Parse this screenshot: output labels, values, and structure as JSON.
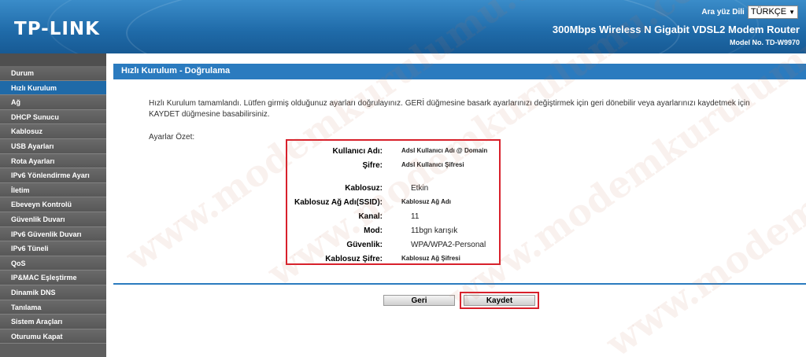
{
  "header": {
    "logo": "TP-LINK",
    "language_label": "Ara yüz Dili",
    "language_value": "TÜRKÇE",
    "product_title": "300Mbps Wireless N Gigabit VDSL2 Modem Router",
    "model_no": "Model No. TD-W9970"
  },
  "sidebar": {
    "items": [
      {
        "label": "Durum"
      },
      {
        "label": "Hızlı Kurulum"
      },
      {
        "label": "Ağ"
      },
      {
        "label": "DHCP Sunucu"
      },
      {
        "label": "Kablosuz"
      },
      {
        "label": "USB Ayarları"
      },
      {
        "label": "Rota Ayarları"
      },
      {
        "label": "IPv6 Yönlendirme Ayarı"
      },
      {
        "label": "İletim"
      },
      {
        "label": "Ebeveyn Kontrolü"
      },
      {
        "label": "Güvenlik Duvarı"
      },
      {
        "label": "IPv6 Güvenlik Duvarı"
      },
      {
        "label": "IPv6 Tüneli"
      },
      {
        "label": "QoS"
      },
      {
        "label": "IP&MAC Eşleştirme"
      },
      {
        "label": "Dinamik DNS"
      },
      {
        "label": "Tanılama"
      },
      {
        "label": "Sistem Araçları"
      },
      {
        "label": "Oturumu Kapat"
      }
    ]
  },
  "main": {
    "title": "Hızlı Kurulum - Doğrulama",
    "intro": "Hızlı Kurulum tamamlandı. Lütfen girmiş olduğunuz ayarları doğrulayınız. GERİ düğmesine basark ayarlarınızı değiştirmek için geri dönebilir veya ayarlarınızı kaydetmek için KAYDET düğmesine basabilirsiniz.",
    "summary_label": "Ayarlar Özet:",
    "summary": {
      "username_label": "Kullanıcı Adı:",
      "username_value": "Adsl Kullanıcı Adı @ Domain",
      "password_label": "Şifre:",
      "password_value": "Adsl Kullanıcı Şifresi",
      "wireless_label": "Kablosuz:",
      "wireless_value": "Etkin",
      "ssid_label": "Kablosuz Ağ Adı(SSID):",
      "ssid_value": "Kablosuz Ağ Adı",
      "channel_label": "Kanal:",
      "channel_value": "11",
      "mode_label": "Mod:",
      "mode_value": "11bgn karışık",
      "security_label": "Güvenlik:",
      "security_value": "WPA/WPA2-Personal",
      "wpass_label": "Kablosuz Şifre:",
      "wpass_value": "Kablosuz Ağ Şifresi"
    },
    "back_label": "Geri",
    "save_label": "Kaydet"
  },
  "watermark": {
    "text": "www.modemkurulumu.com"
  },
  "colors": {
    "accent": "#2b7bbf",
    "highlight": "#d8202b",
    "sidebar": "#5e5e5e"
  }
}
